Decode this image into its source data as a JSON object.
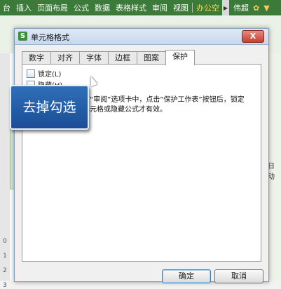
{
  "ribbon": {
    "tabs": [
      "台",
      "插入",
      "页面布局",
      "公式",
      "数据",
      "表格样式",
      "审阅",
      "视图",
      "办公空"
    ],
    "user": "伟超",
    "right_text": "日动"
  },
  "dialog": {
    "title": "单元格格式",
    "app_icon": "S",
    "close_label": "X",
    "tabs": [
      "数字",
      "对齐",
      "字体",
      "边框",
      "图案",
      "保护"
    ],
    "active_tab": "保护",
    "lock_label": "锁定(L)",
    "hide_label": "隐藏(H)",
    "description": "在“审阅”选项卡中，点击“保护工作表”按钮后，锁定单元格或隐藏公式才有效。",
    "ok_label": "确定",
    "cancel_label": "取消"
  },
  "callout": {
    "text": "去掉勾选"
  },
  "row_numbers": [
    "0",
    "1",
    "2",
    "3"
  ]
}
